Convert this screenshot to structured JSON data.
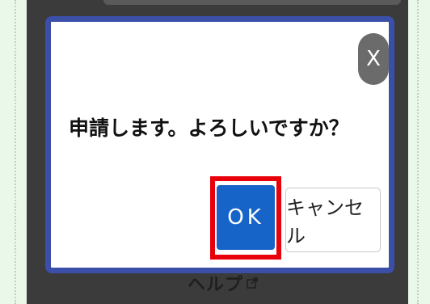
{
  "dialog": {
    "message": "申請します。よろしいですか？",
    "close_icon": "close-icon",
    "close_glyph": "X",
    "ok_label": "OK",
    "cancel_label": "キャンセル"
  },
  "background": {
    "help_label": "ヘルプ",
    "help_icon": "external-link-icon"
  },
  "colors": {
    "dialog_border": "#3b4fa8",
    "ok_button": "#1664c8",
    "highlight": "#e8000b",
    "overlay": "#3b3b3b",
    "page_background": "#eaf8ea"
  }
}
